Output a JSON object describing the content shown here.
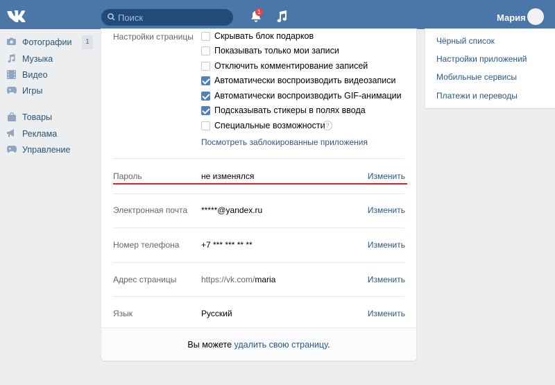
{
  "header": {
    "search_placeholder": "Поиск",
    "notification_count": "1",
    "user_name": "Мария",
    "top_strip_text": "..."
  },
  "nav": {
    "items": [
      {
        "label": "Фотографии",
        "icon": "camera-icon",
        "count": "1"
      },
      {
        "label": "Музыка",
        "icon": "music-icon"
      },
      {
        "label": "Видео",
        "icon": "video-icon"
      },
      {
        "label": "Игры",
        "icon": "gamepad-icon"
      },
      {
        "label": "Товары",
        "icon": "bag-icon"
      },
      {
        "label": "Реклама",
        "icon": "megaphone-icon"
      },
      {
        "label": "Управление",
        "icon": "gamepad-icon"
      }
    ]
  },
  "settings": {
    "page_section_label": "Настройки страницы",
    "options": [
      {
        "label": "Скрывать блок подарков",
        "checked": false
      },
      {
        "label": "Показывать только мои записи",
        "checked": false
      },
      {
        "label": "Отключить комментирование записей",
        "checked": false
      },
      {
        "label": "Автоматически воспроизводить видеозаписи",
        "checked": true
      },
      {
        "label": "Автоматически воспроизводить GIF-анимации",
        "checked": true
      },
      {
        "label": "Подсказывать стикеры в полях ввода",
        "checked": true
      },
      {
        "label": "Специальные возможности",
        "checked": false,
        "help": "?"
      }
    ],
    "blocked_apps_link": "Посмотреть заблокированные приложения",
    "change_label": "Изменить",
    "fields": [
      {
        "label": "Пароль",
        "value": "не изменялся"
      },
      {
        "label": "Электронная почта",
        "value": "*****@yandex.ru"
      },
      {
        "label": "Номер телефона",
        "value": "+7 *** *** ** **"
      },
      {
        "label": "Адрес страницы",
        "value_prefix": "https://vk.com/",
        "value_id": "maria"
      },
      {
        "label": "Язык",
        "value": "Русский"
      }
    ],
    "footer_text_before": "Вы можете ",
    "footer_link": "удалить свою страницу",
    "footer_text_after": "."
  },
  "right_menu": {
    "items": [
      "Чёрный список",
      "Настройки приложений",
      "Мобильные сервисы",
      "Платежи и переводы"
    ]
  },
  "colors": {
    "header": "#4a76a8",
    "link": "#2a5885",
    "checkbox": "#5181b8",
    "highlight": "#d9222a"
  }
}
